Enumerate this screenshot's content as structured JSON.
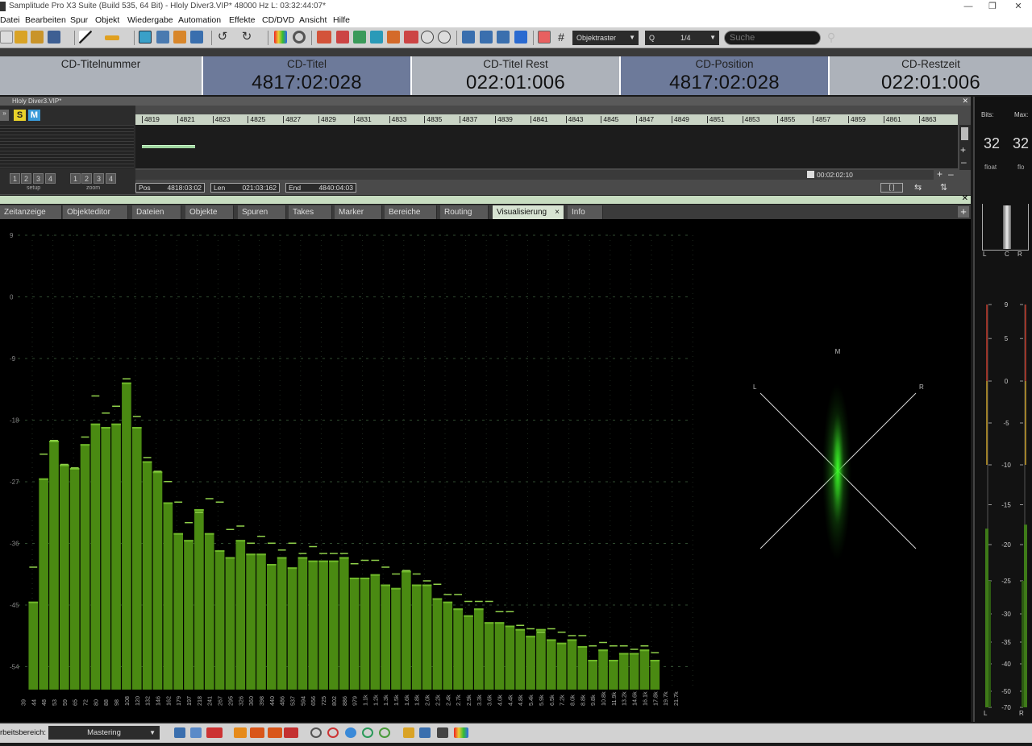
{
  "window": {
    "title": "Samplitude Pro X3 Suite (Build 535, 64 Bit)  -  Hloly Diver3.VIP*   48000 Hz L: 03:32:44:07*"
  },
  "menu": [
    "Datei",
    "Bearbeiten",
    "Spur",
    "Objekt",
    "Wiedergabe",
    "Automation",
    "Effekte",
    "CD/DVD",
    "Ansicht",
    "Hilfe"
  ],
  "toolbar": {
    "grid_mode": "Objektraster",
    "quantize_label": "Q",
    "quantize_value": "1/4",
    "search_placeholder": "Suche"
  },
  "cd_display": [
    {
      "label": "CD-Titelnummer",
      "value": ""
    },
    {
      "label": "CD-Titel",
      "value": "4817:02:028"
    },
    {
      "label": "CD-Titel Rest",
      "value": "022:01:006"
    },
    {
      "label": "CD-Position",
      "value": "4817:02:028"
    },
    {
      "label": "CD-Restzeit",
      "value": "022:01:006"
    }
  ],
  "track_window": {
    "title": "Hloly Diver3.VIP*",
    "solo_label": "S",
    "mute_label": "M",
    "setup_label": "setup",
    "zoom_label": "zoom",
    "setup_buttons": [
      "1",
      "2",
      "3",
      "4"
    ],
    "zoom_buttons": [
      "1",
      "2",
      "3",
      "4"
    ],
    "ruler_marks": [
      "4819",
      "4821",
      "4823",
      "4825",
      "4827",
      "4829",
      "4831",
      "4833",
      "4835",
      "4837",
      "4839",
      "4841",
      "4843",
      "4845",
      "4847",
      "4849",
      "4851",
      "4853",
      "4855",
      "4857",
      "4859",
      "4861",
      "4863"
    ],
    "scroll_time": "00:02:02:10",
    "pos_label": "Pos",
    "pos_value": "4818:03:02",
    "len_label": "Len",
    "len_value": "021:03:162",
    "end_label": "End",
    "end_value": "4840:04:03"
  },
  "tabs": [
    "Zeitanzeige",
    "Objekteditor",
    "Dateien",
    "Objekte",
    "Spuren",
    "Takes",
    "Marker",
    "Bereiche",
    "Routing",
    "Visualisierung",
    "Info"
  ],
  "active_tab": "Visualisierung",
  "meter_panel": {
    "bits_label": "Bits:",
    "max_label": "Max:",
    "bits_value": "32",
    "max_value": "32",
    "bits_format": "float",
    "max_format": "flo",
    "corr_labels": [
      "L",
      "C",
      "R"
    ],
    "scale": [
      "9",
      "5",
      "0",
      "-5",
      "-10",
      "-15",
      "-20",
      "-25",
      "-30",
      "-35",
      "-40",
      "-50",
      "-70"
    ],
    "channel_labels": [
      "L",
      "R"
    ],
    "level_L": -18,
    "level_R": -17.5
  },
  "goniometer": {
    "labels": {
      "m": "M",
      "l": "L",
      "r": "R"
    }
  },
  "statusbar": {
    "workspace_label": "rbeitsbereich:",
    "workspace_value": "Mastering"
  },
  "colors": {
    "accent_green": "#4a8a12",
    "bar_top": "#6fb82a",
    "cd_highlight": "#6d7a9a",
    "cd_plain": "#adb2ba"
  },
  "chart_data": {
    "type": "bar",
    "title": "",
    "xlabel": "",
    "ylabel": "",
    "ylim": [
      -60,
      9
    ],
    "yticks": [
      "9",
      "0",
      "-9",
      "-18",
      "-27",
      "-36",
      "-45",
      "-54"
    ],
    "categories": [
      "39",
      "44",
      "48",
      "53",
      "59",
      "65",
      "72",
      "80",
      "88",
      "98",
      "108",
      "120",
      "132",
      "146",
      "162",
      "179",
      "197",
      "218",
      "241",
      "267",
      "295",
      "326",
      "360",
      "398",
      "440",
      "486",
      "537",
      "594",
      "656",
      "725",
      "802",
      "886",
      "979",
      "1.1k",
      "1.2k",
      "1.3k",
      "1.5k",
      "1.6k",
      "1.8k",
      "2.0k",
      "2.2k",
      "2.4k",
      "2.7k",
      "2.9k",
      "3.3k",
      "3.6k",
      "4.0k",
      "4.4k",
      "4.8k",
      "5.4k",
      "5.9k",
      "6.5k",
      "7.2k",
      "8.0k",
      "8.8k",
      "9.8k",
      "10.8k",
      "11.9k",
      "13.2k",
      "14.6k",
      "16.1k",
      "17.8k",
      "19.7k",
      "21.7k"
    ],
    "values": [
      -60,
      -44.5,
      -26.5,
      -21,
      -24.5,
      -25,
      -21.5,
      -18.5,
      -19,
      -18.5,
      -12.5,
      -19,
      -24,
      -25.5,
      -30,
      -34.5,
      -35.5,
      -31,
      -34.5,
      -37,
      -38,
      -35.5,
      -37.5,
      -37.5,
      -39,
      -38,
      -39.5,
      -38,
      -38.5,
      -38.5,
      -38.5,
      -38,
      -41,
      -41,
      -40.5,
      -42,
      -42.5,
      -40,
      -42,
      -42,
      -44,
      -44.5,
      -45.5,
      -46.5,
      -45.5,
      -47.5,
      -47.5,
      -48,
      -48.5,
      -49.5,
      -48.5,
      -50,
      -50.5,
      -50,
      -51,
      -53,
      -51.5,
      -53,
      -52,
      -52,
      -51.5,
      -53,
      -60,
      -60
    ],
    "peaks": [
      -60,
      -39.5,
      -23,
      -21,
      -24.5,
      -25,
      -20.5,
      -14.5,
      -17,
      -16,
      -12,
      -17.5,
      -23.5,
      -25.5,
      -27,
      -30,
      -33,
      -31.5,
      -29.5,
      -30,
      -34,
      -33.5,
      -36,
      -35,
      -36,
      -37,
      -36,
      -37.5,
      -36.5,
      -37.5,
      -37.5,
      -37.5,
      -39,
      -38.5,
      -38.5,
      -39.5,
      -40.5,
      -40,
      -40.5,
      -41.5,
      -42,
      -43.5,
      -43.5,
      -44.5,
      -44.5,
      -44.5,
      -46,
      -46,
      -48,
      -48.5,
      -49,
      -48.5,
      -49,
      -49.5,
      -49.5,
      -51,
      -50.5,
      -51,
      -51,
      -51.5,
      -51,
      -52,
      -60,
      -60
    ]
  }
}
